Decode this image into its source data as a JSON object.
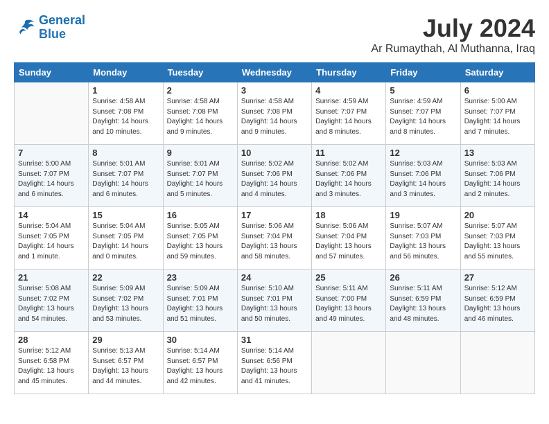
{
  "header": {
    "logo_line1": "General",
    "logo_line2": "Blue",
    "month": "July 2024",
    "location": "Ar Rumaythah, Al Muthanna, Iraq"
  },
  "days_of_week": [
    "Sunday",
    "Monday",
    "Tuesday",
    "Wednesday",
    "Thursday",
    "Friday",
    "Saturday"
  ],
  "weeks": [
    [
      {
        "day": "",
        "info": ""
      },
      {
        "day": "1",
        "info": "Sunrise: 4:58 AM\nSunset: 7:08 PM\nDaylight: 14 hours\nand 10 minutes."
      },
      {
        "day": "2",
        "info": "Sunrise: 4:58 AM\nSunset: 7:08 PM\nDaylight: 14 hours\nand 9 minutes."
      },
      {
        "day": "3",
        "info": "Sunrise: 4:58 AM\nSunset: 7:08 PM\nDaylight: 14 hours\nand 9 minutes."
      },
      {
        "day": "4",
        "info": "Sunrise: 4:59 AM\nSunset: 7:07 PM\nDaylight: 14 hours\nand 8 minutes."
      },
      {
        "day": "5",
        "info": "Sunrise: 4:59 AM\nSunset: 7:07 PM\nDaylight: 14 hours\nand 8 minutes."
      },
      {
        "day": "6",
        "info": "Sunrise: 5:00 AM\nSunset: 7:07 PM\nDaylight: 14 hours\nand 7 minutes."
      }
    ],
    [
      {
        "day": "7",
        "info": "Sunrise: 5:00 AM\nSunset: 7:07 PM\nDaylight: 14 hours\nand 6 minutes."
      },
      {
        "day": "8",
        "info": "Sunrise: 5:01 AM\nSunset: 7:07 PM\nDaylight: 14 hours\nand 6 minutes."
      },
      {
        "day": "9",
        "info": "Sunrise: 5:01 AM\nSunset: 7:07 PM\nDaylight: 14 hours\nand 5 minutes."
      },
      {
        "day": "10",
        "info": "Sunrise: 5:02 AM\nSunset: 7:06 PM\nDaylight: 14 hours\nand 4 minutes."
      },
      {
        "day": "11",
        "info": "Sunrise: 5:02 AM\nSunset: 7:06 PM\nDaylight: 14 hours\nand 3 minutes."
      },
      {
        "day": "12",
        "info": "Sunrise: 5:03 AM\nSunset: 7:06 PM\nDaylight: 14 hours\nand 3 minutes."
      },
      {
        "day": "13",
        "info": "Sunrise: 5:03 AM\nSunset: 7:06 PM\nDaylight: 14 hours\nand 2 minutes."
      }
    ],
    [
      {
        "day": "14",
        "info": "Sunrise: 5:04 AM\nSunset: 7:05 PM\nDaylight: 14 hours\nand 1 minute."
      },
      {
        "day": "15",
        "info": "Sunrise: 5:04 AM\nSunset: 7:05 PM\nDaylight: 14 hours\nand 0 minutes."
      },
      {
        "day": "16",
        "info": "Sunrise: 5:05 AM\nSunset: 7:05 PM\nDaylight: 13 hours\nand 59 minutes."
      },
      {
        "day": "17",
        "info": "Sunrise: 5:06 AM\nSunset: 7:04 PM\nDaylight: 13 hours\nand 58 minutes."
      },
      {
        "day": "18",
        "info": "Sunrise: 5:06 AM\nSunset: 7:04 PM\nDaylight: 13 hours\nand 57 minutes."
      },
      {
        "day": "19",
        "info": "Sunrise: 5:07 AM\nSunset: 7:03 PM\nDaylight: 13 hours\nand 56 minutes."
      },
      {
        "day": "20",
        "info": "Sunrise: 5:07 AM\nSunset: 7:03 PM\nDaylight: 13 hours\nand 55 minutes."
      }
    ],
    [
      {
        "day": "21",
        "info": "Sunrise: 5:08 AM\nSunset: 7:02 PM\nDaylight: 13 hours\nand 54 minutes."
      },
      {
        "day": "22",
        "info": "Sunrise: 5:09 AM\nSunset: 7:02 PM\nDaylight: 13 hours\nand 53 minutes."
      },
      {
        "day": "23",
        "info": "Sunrise: 5:09 AM\nSunset: 7:01 PM\nDaylight: 13 hours\nand 51 minutes."
      },
      {
        "day": "24",
        "info": "Sunrise: 5:10 AM\nSunset: 7:01 PM\nDaylight: 13 hours\nand 50 minutes."
      },
      {
        "day": "25",
        "info": "Sunrise: 5:11 AM\nSunset: 7:00 PM\nDaylight: 13 hours\nand 49 minutes."
      },
      {
        "day": "26",
        "info": "Sunrise: 5:11 AM\nSunset: 6:59 PM\nDaylight: 13 hours\nand 48 minutes."
      },
      {
        "day": "27",
        "info": "Sunrise: 5:12 AM\nSunset: 6:59 PM\nDaylight: 13 hours\nand 46 minutes."
      }
    ],
    [
      {
        "day": "28",
        "info": "Sunrise: 5:12 AM\nSunset: 6:58 PM\nDaylight: 13 hours\nand 45 minutes."
      },
      {
        "day": "29",
        "info": "Sunrise: 5:13 AM\nSunset: 6:57 PM\nDaylight: 13 hours\nand 44 minutes."
      },
      {
        "day": "30",
        "info": "Sunrise: 5:14 AM\nSunset: 6:57 PM\nDaylight: 13 hours\nand 42 minutes."
      },
      {
        "day": "31",
        "info": "Sunrise: 5:14 AM\nSunset: 6:56 PM\nDaylight: 13 hours\nand 41 minutes."
      },
      {
        "day": "",
        "info": ""
      },
      {
        "day": "",
        "info": ""
      },
      {
        "day": "",
        "info": ""
      }
    ]
  ]
}
